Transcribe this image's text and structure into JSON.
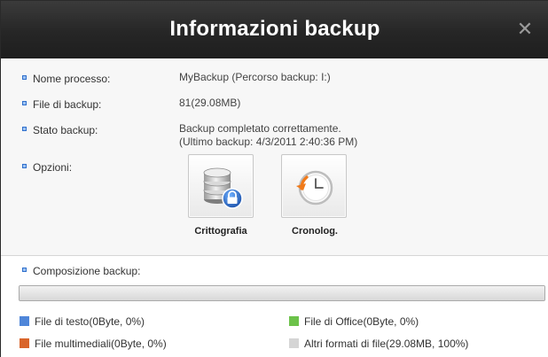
{
  "window": {
    "title": "Informazioni backup",
    "close_glyph": "✕"
  },
  "info": {
    "process": {
      "label": "Nome processo:",
      "value": "MyBackup (Percorso backup: I:)"
    },
    "files": {
      "label": "File di backup:",
      "value": "81(29.08MB)"
    },
    "status": {
      "label": "Stato backup:",
      "line1": "Backup completato correttamente.",
      "line2": "(Ultimo backup: 4/3/2011 2:40:36 PM)"
    },
    "options": {
      "label": "Opzioni:",
      "encryption_label": "Crittografia",
      "history_label": "Cronolog."
    }
  },
  "composition": {
    "label": "Composizione backup:",
    "progress_fraction": 1.0,
    "legend": {
      "text": {
        "label": "File di testo(0Byte, 0%)",
        "color": "#4f86d9"
      },
      "office": {
        "label": "File di Office(0Byte, 0%)",
        "color": "#6cc24a"
      },
      "media": {
        "label": "File multimediali(0Byte, 0%)",
        "color": "#d9652b"
      },
      "other": {
        "label": "Altri formati di file(29.08MB, 100%)",
        "color": "#d5d5d5"
      }
    }
  },
  "icons": {
    "encryption": "database-lock-icon",
    "history": "clock-restore-icon",
    "close": "close-icon",
    "bullet": "bullet-icon"
  }
}
